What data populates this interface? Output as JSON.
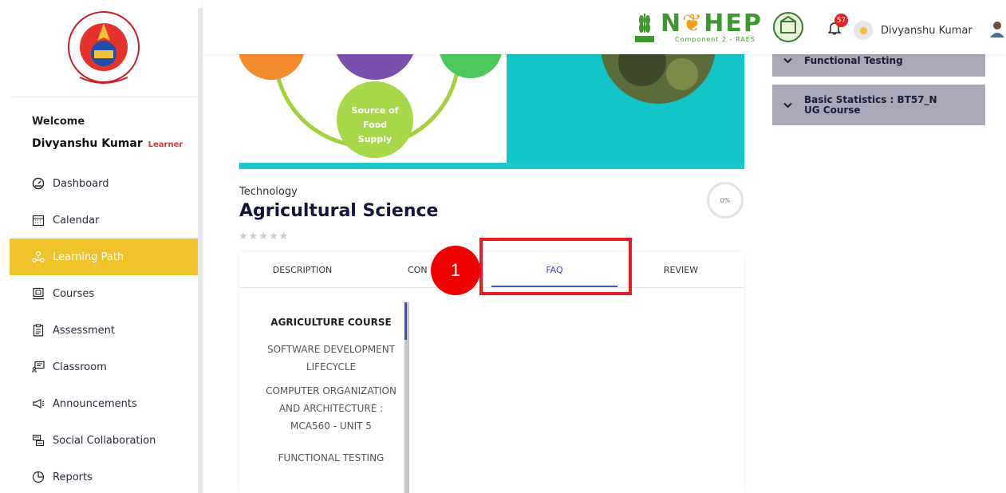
{
  "sidebar": {
    "welcome": "Welcome",
    "user_name": "Divyanshu Kumar",
    "role": "Learner",
    "items": [
      {
        "label": "Dashboard",
        "icon": "dashboard-icon"
      },
      {
        "label": "Calendar",
        "icon": "calendar-icon"
      },
      {
        "label": "Learning Path",
        "icon": "learning-path-icon",
        "active": true
      },
      {
        "label": "Courses",
        "icon": "courses-icon"
      },
      {
        "label": "Assessment",
        "icon": "assessment-icon"
      },
      {
        "label": "Classroom",
        "icon": "classroom-icon"
      },
      {
        "label": "Announcements",
        "icon": "announcements-icon"
      },
      {
        "label": "Social Collaboration",
        "icon": "social-collaboration-icon"
      },
      {
        "label": "Reports",
        "icon": "reports-icon"
      }
    ],
    "active_color": "#f0c22b"
  },
  "header": {
    "brand": "NAHEP",
    "brand_sub": "Component 2 - RAES",
    "notification_count": "57",
    "user_name": "Divyanshu Kumar"
  },
  "hero": {
    "circle_label": "Source of Food Supply"
  },
  "course": {
    "category": "Technology",
    "title": "Agricultural Science",
    "stars": "★★★★★",
    "rating": 0,
    "progress": "0%"
  },
  "tabs": [
    {
      "label": "DESCRIPTION"
    },
    {
      "label": "CON"
    },
    {
      "label": "FAQ",
      "active": true
    },
    {
      "label": "REVIEW"
    }
  ],
  "faq": {
    "items": [
      "AGRICULTURE COURSE",
      "SOFTWARE DEVELOPMENT LIFECYCLE",
      "COMPUTER ORGANIZATION AND ARCHITECTURE : MCA560 - UNIT 5",
      "FUNCTIONAL TESTING"
    ]
  },
  "annotation": {
    "step": "1",
    "color": "#e51c23"
  },
  "right_panels": [
    {
      "label": "Functional Testing"
    },
    {
      "label": "Basic Statistics : BT57_N UG Course"
    }
  ]
}
